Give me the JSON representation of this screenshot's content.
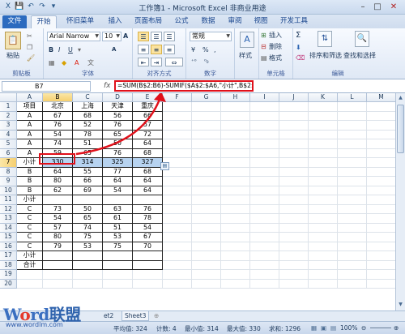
{
  "window": {
    "title": "工作簿1 - Microsoft Excel 非商业用途",
    "quick_access": [
      "💾",
      "↶",
      "↷",
      "▾"
    ],
    "controls": [
      "–",
      "□",
      "✕"
    ]
  },
  "tabs": [
    "文件",
    "开始",
    "插入",
    "页面布局",
    "公式",
    "数据",
    "审阅",
    "视图",
    "开发工具"
  ],
  "tabs_partial": {
    "t2": "怀旧菜单"
  },
  "ribbon": {
    "paste": "粘贴",
    "clipboard_label": "剪贴板",
    "font_name": "Arial Narrow",
    "font_size": "10",
    "bold": "B",
    "italic": "I",
    "underline": "U",
    "grow": "A",
    "shrink": "A",
    "font_label": "字体",
    "align_label": "对齐方式",
    "number_format": "常规",
    "percent": "%",
    "comma": ",",
    "number_label": "数字",
    "style": "样式",
    "insert": "插入",
    "delete": "删除",
    "format": "格式",
    "cells_label": "单元格",
    "sigma": "Σ",
    "sort_filter": "排序和筛选",
    "find_select": "查找和选择",
    "edit_label": "编辑"
  },
  "formula_bar": {
    "name_box": "B7",
    "fx": "fx",
    "formula": "=SUM(B$2:B6)-SUMIF($A$2:$A6,\"小计\",B$2:B6)*2"
  },
  "grid": {
    "columns": [
      "A",
      "B",
      "C",
      "D",
      "E",
      "F",
      "G",
      "H",
      "I",
      "J",
      "K",
      "L",
      "M"
    ],
    "selected_column": "B",
    "selected_row": "7",
    "rows": [
      [
        "项目",
        "北京",
        "上海",
        "天津",
        "重庆"
      ],
      [
        "A",
        "67",
        "68",
        "56",
        "66"
      ],
      [
        "A",
        "76",
        "52",
        "76",
        "57"
      ],
      [
        "A",
        "54",
        "78",
        "65",
        "72"
      ],
      [
        "A",
        "74",
        "51",
        "50",
        "64"
      ],
      [
        "A",
        "59",
        "65",
        "76",
        "68"
      ],
      [
        "小计",
        "330",
        "314",
        "325",
        "327"
      ],
      [
        "B",
        "64",
        "55",
        "77",
        "68"
      ],
      [
        "B",
        "80",
        "66",
        "64",
        "64"
      ],
      [
        "B",
        "62",
        "69",
        "54",
        "64"
      ],
      [
        "小计",
        "",
        "",
        "",
        ""
      ],
      [
        "C",
        "73",
        "50",
        "63",
        "76"
      ],
      [
        "C",
        "54",
        "65",
        "61",
        "78"
      ],
      [
        "C",
        "57",
        "74",
        "51",
        "54"
      ],
      [
        "C",
        "80",
        "75",
        "53",
        "67"
      ],
      [
        "C",
        "79",
        "53",
        "75",
        "70"
      ],
      [
        "小计",
        "",
        "",
        "",
        ""
      ],
      [
        "合计",
        "",
        "",
        "",
        ""
      ],
      [
        "",
        "",
        "",
        "",
        ""
      ],
      [
        "",
        "",
        "",
        "",
        ""
      ]
    ]
  },
  "sheet_tabs": [
    "et2",
    "Sheet3"
  ],
  "status": {
    "average": "平均值: 324",
    "count": "计数: 4",
    "min": "最小值: 314",
    "max": "最大值: 330",
    "sum": "求和: 1296",
    "zoom": "100%"
  },
  "watermark": {
    "brand_a": "W",
    "brand_o": "o",
    "brand_b": "rd",
    "brand_cn": "联盟",
    "url": "www.wordlm.com"
  }
}
